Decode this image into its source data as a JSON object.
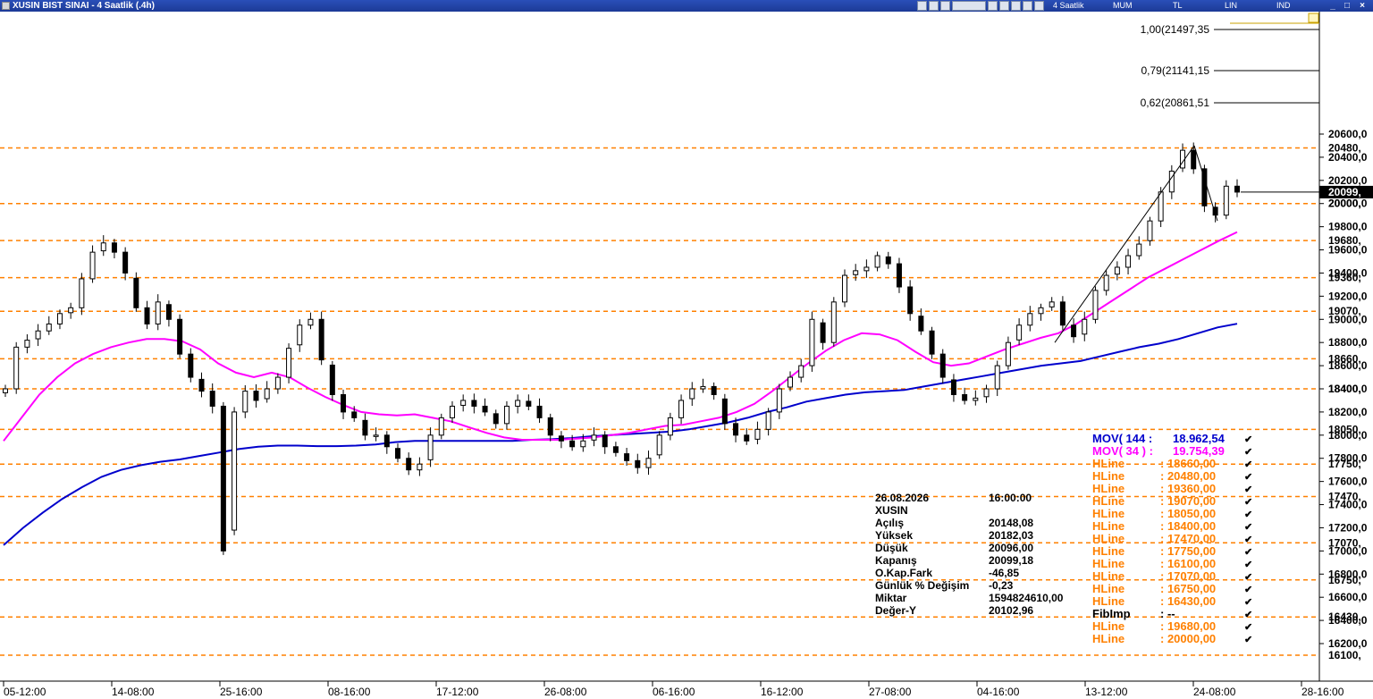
{
  "window": {
    "title": "XUSIN BIST SINAI - 4 Saatlik (.4h)",
    "modes": [
      "4 Saatlik",
      "MUM",
      "TL",
      "LIN",
      "IND"
    ],
    "controls": [
      "_",
      "□",
      "×"
    ]
  },
  "chart_data": {
    "type": "candlestick",
    "symbol": "XUSIN",
    "y_axis": {
      "ticks": [
        16200,
        16400,
        16600,
        16800,
        17000,
        17200,
        17400,
        17600,
        17800,
        18000,
        18200,
        18400,
        18600,
        18800,
        19000,
        19200,
        19400,
        19600,
        19800,
        20000,
        20200,
        20400,
        20600
      ],
      "tick_labels": [
        "16200,0",
        "16400,0",
        "16600,0",
        "16800,0",
        "17000,0",
        "17200,0",
        "17400,0",
        "17600,0",
        "17800,0",
        "18000,0",
        "18200,0",
        "18400,0",
        "18600,0",
        "18800,0",
        "19000,0",
        "19200,0",
        "19400,0",
        "19600,0",
        "19800,0",
        "20000,0",
        "20200,0",
        "20400,0",
        "20600,0"
      ]
    },
    "x_axis": {
      "tick_labels": [
        "05-12:00",
        "14-08:00",
        "25-16:00",
        "08-16:00",
        "17-12:00",
        "26-08:00",
        "06-16:00",
        "16-12:00",
        "27-08:00",
        "04-16:00",
        "13-12:00",
        "24-08:00",
        "28-16:00"
      ]
    },
    "hlines": [
      20480,
      20000,
      19680,
      19360,
      19070,
      18660,
      18400,
      18050,
      17750,
      17470,
      17070,
      16750,
      16430,
      16100
    ],
    "hline_labels": [
      "20480,",
      "20000,",
      "19680,",
      "19360,",
      "19070,",
      "18660,",
      "18400,",
      "18050,",
      "17750,",
      "17470,",
      "17070,",
      "16750,",
      "16430,",
      "16100,"
    ],
    "current_price_label": "20099,",
    "fib_levels": [
      {
        "ratio": "1,00",
        "value": 21497.35,
        "label": "1,00(21497,35"
      },
      {
        "ratio": "0,79",
        "value": 21141.15,
        "label": "0,79(21141,15"
      },
      {
        "ratio": "0,62",
        "value": 20861.51,
        "label": "0,62(20861,51"
      }
    ],
    "info": [
      [
        "26.08.2026",
        "16:00:00"
      ],
      [
        "XUSIN",
        ""
      ],
      [
        "Açılış",
        "20148,08"
      ],
      [
        "Yüksek",
        "20182,03"
      ],
      [
        "Düşük",
        "20096,00"
      ],
      [
        "Kapanış",
        "20099,18"
      ],
      [
        "O.Kap.Fark",
        "-46,85"
      ],
      [
        "Günlük % Değişim",
        "-0,23"
      ],
      [
        "Miktar",
        "1594824610,00"
      ],
      [
        "Değer-Y",
        "20102,96"
      ]
    ],
    "legend": [
      {
        "name": "MOV( 144 :",
        "value": "18.962,54",
        "color": "#0000cc"
      },
      {
        "name": "MOV( 34 ) :",
        "value": "19.754,39",
        "color": "#ff00ff"
      },
      {
        "name": "HLine",
        "value": ": 18660,00",
        "color": "#ff8000"
      },
      {
        "name": "HLine",
        "value": ": 20480,00",
        "color": "#ff8000"
      },
      {
        "name": "HLine",
        "value": ": 19360,00",
        "color": "#ff8000"
      },
      {
        "name": "HLine",
        "value": ": 19070,00",
        "color": "#ff8000"
      },
      {
        "name": "HLine",
        "value": ": 18050,00",
        "color": "#ff8000"
      },
      {
        "name": "HLine",
        "value": ": 18400,00",
        "color": "#ff8000"
      },
      {
        "name": "HLine",
        "value": ": 17470,00",
        "color": "#ff8000"
      },
      {
        "name": "HLine",
        "value": ": 17750,00",
        "color": "#ff8000"
      },
      {
        "name": "HLine",
        "value": ": 16100,00",
        "color": "#ff8000"
      },
      {
        "name": "HLine",
        "value": ": 17070,00",
        "color": "#ff8000"
      },
      {
        "name": "HLine",
        "value": ": 16750,00",
        "color": "#ff8000"
      },
      {
        "name": "HLine",
        "value": ": 16430,00",
        "color": "#ff8000"
      },
      {
        "name": "FibImp",
        "value": ": --",
        "color": "#000000"
      },
      {
        "name": "HLine",
        "value": ": 19680,00",
        "color": "#ff8000"
      },
      {
        "name": "HLine",
        "value": ": 20000,00",
        "color": "#ff8000"
      }
    ],
    "colors": {
      "hline": "#ff8000",
      "ma144": "#0000cc",
      "ma34": "#ff00ff",
      "bull": "#ffffff",
      "bear": "#000000"
    },
    "close_path": [
      18400,
      18760,
      18820,
      18900,
      18960,
      19050,
      19100,
      19350,
      19580,
      19660,
      19580,
      19400,
      19100,
      18960,
      19150,
      19000,
      18700,
      18500,
      18380,
      18250,
      17000,
      18200,
      18380,
      18300,
      18400,
      18500,
      18750,
      18950,
      19000,
      18650,
      18350,
      18200,
      18150,
      18000,
      18000,
      17900,
      17800,
      17700,
      17750,
      18000,
      18150,
      18250,
      18300,
      18250,
      18200,
      18100,
      18250,
      18300,
      18250,
      18150,
      18000,
      17950,
      17900,
      17950,
      18000,
      17900,
      17850,
      17780,
      17720,
      17800,
      18000,
      18150,
      18300,
      18400,
      18420,
      18350,
      18100,
      18000,
      17950,
      18050,
      18200,
      18400,
      18500,
      18600,
      19000,
      18800,
      19150,
      19380,
      19420,
      19450,
      19550,
      19480,
      19280,
      19050,
      18900,
      18700,
      18500,
      18350,
      18300,
      18320,
      18400,
      18600,
      18800,
      18950,
      19050,
      19100,
      19150,
      18950,
      18850,
      19000,
      19250,
      19380,
      19450,
      19550,
      19650,
      19850,
      20100,
      20280,
      20460,
      20300,
      19980,
      19900,
      20150,
      20099
    ],
    "ma34_path": [
      17950,
      18150,
      18350,
      18500,
      18620,
      18700,
      18760,
      18800,
      18830,
      18830,
      18810,
      18740,
      18620,
      18540,
      18500,
      18540,
      18500,
      18410,
      18330,
      18260,
      18200,
      18180,
      18170,
      18180,
      18150,
      18120,
      18070,
      18020,
      17980,
      17960,
      17960,
      17960,
      17970,
      17980,
      18000,
      18020,
      18050,
      18080,
      18090,
      18120,
      18150,
      18200,
      18270,
      18380,
      18500,
      18620,
      18730,
      18820,
      18880,
      18870,
      18820,
      18720,
      18630,
      18600,
      18620,
      18680,
      18740,
      18790,
      18840,
      18880,
      18960,
      19060,
      19160,
      19260,
      19360,
      19440,
      19520,
      19600,
      19680,
      19754
    ],
    "ma144_path": [
      17050,
      17200,
      17330,
      17450,
      17550,
      17640,
      17700,
      17740,
      17770,
      17790,
      17820,
      17850,
      17880,
      17900,
      17910,
      17910,
      17905,
      17905,
      17910,
      17920,
      17940,
      17950,
      17950,
      17950,
      17950,
      17950,
      17950,
      17960,
      17965,
      17975,
      17990,
      18000,
      18010,
      18020,
      18030,
      18050,
      18080,
      18110,
      18150,
      18200,
      18240,
      18290,
      18320,
      18350,
      18370,
      18380,
      18390,
      18420,
      18450,
      18480,
      18510,
      18540,
      18570,
      18600,
      18620,
      18640,
      18680,
      18720,
      18760,
      18790,
      18830,
      18880,
      18930,
      18962
    ]
  }
}
